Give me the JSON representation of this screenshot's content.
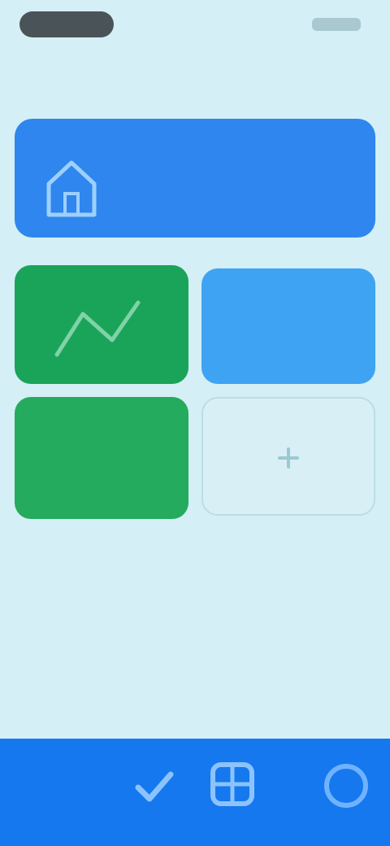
{
  "status_bar": {
    "time": "",
    "pill_color": "#4a5458"
  },
  "header": {
    "title": ""
  },
  "banner": {
    "title": "",
    "subtitle": "",
    "icon": "house-icon",
    "color": "#2e86ee"
  },
  "tiles": [
    {
      "label": "",
      "icon": "chart-icon",
      "color": "#1aa45a"
    },
    {
      "label": "",
      "icon": "blank",
      "color": "#3ea3f3"
    },
    {
      "label": "",
      "icon": "blank",
      "color": "#24ab5d"
    },
    {
      "label": "",
      "icon": "plus-icon",
      "color": "#d8f0f5"
    }
  ],
  "bottom_bar": {
    "color": "#1578ef",
    "items": [
      {
        "icon": "check-icon"
      },
      {
        "icon": "grid-icon"
      },
      {
        "icon": "more-icon"
      }
    ]
  }
}
